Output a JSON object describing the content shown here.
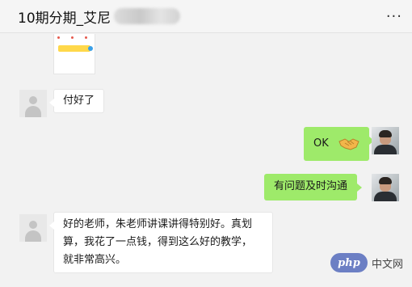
{
  "header": {
    "title": "10期分期_艾尼",
    "more_icon": "more-dots-icon",
    "more_label": "···"
  },
  "messages": [
    {
      "id": "image",
      "side": "in",
      "type": "image"
    },
    {
      "id": "m1",
      "side": "in",
      "avatar": "default-avatar-icon",
      "text": "付好了"
    },
    {
      "id": "m2",
      "side": "out",
      "avatar": "user-photo",
      "text": "OK",
      "emoji": "handshake-icon"
    },
    {
      "id": "m3",
      "side": "out",
      "avatar": "user-photo",
      "text": "有问题及时沟通"
    },
    {
      "id": "m4",
      "side": "in",
      "avatar": "default-avatar-icon",
      "lines": [
        "好的老师，朱老师讲课讲得特别好。真划",
        "算，我花了一点钱，得到这么好的教学，",
        "就非常高兴。"
      ]
    }
  ],
  "watermark": {
    "badge": "php",
    "site": "中文网"
  },
  "colors": {
    "out_bubble": "#9eea6a",
    "in_bubble": "#ffffff",
    "background": "#f2f2f2"
  }
}
